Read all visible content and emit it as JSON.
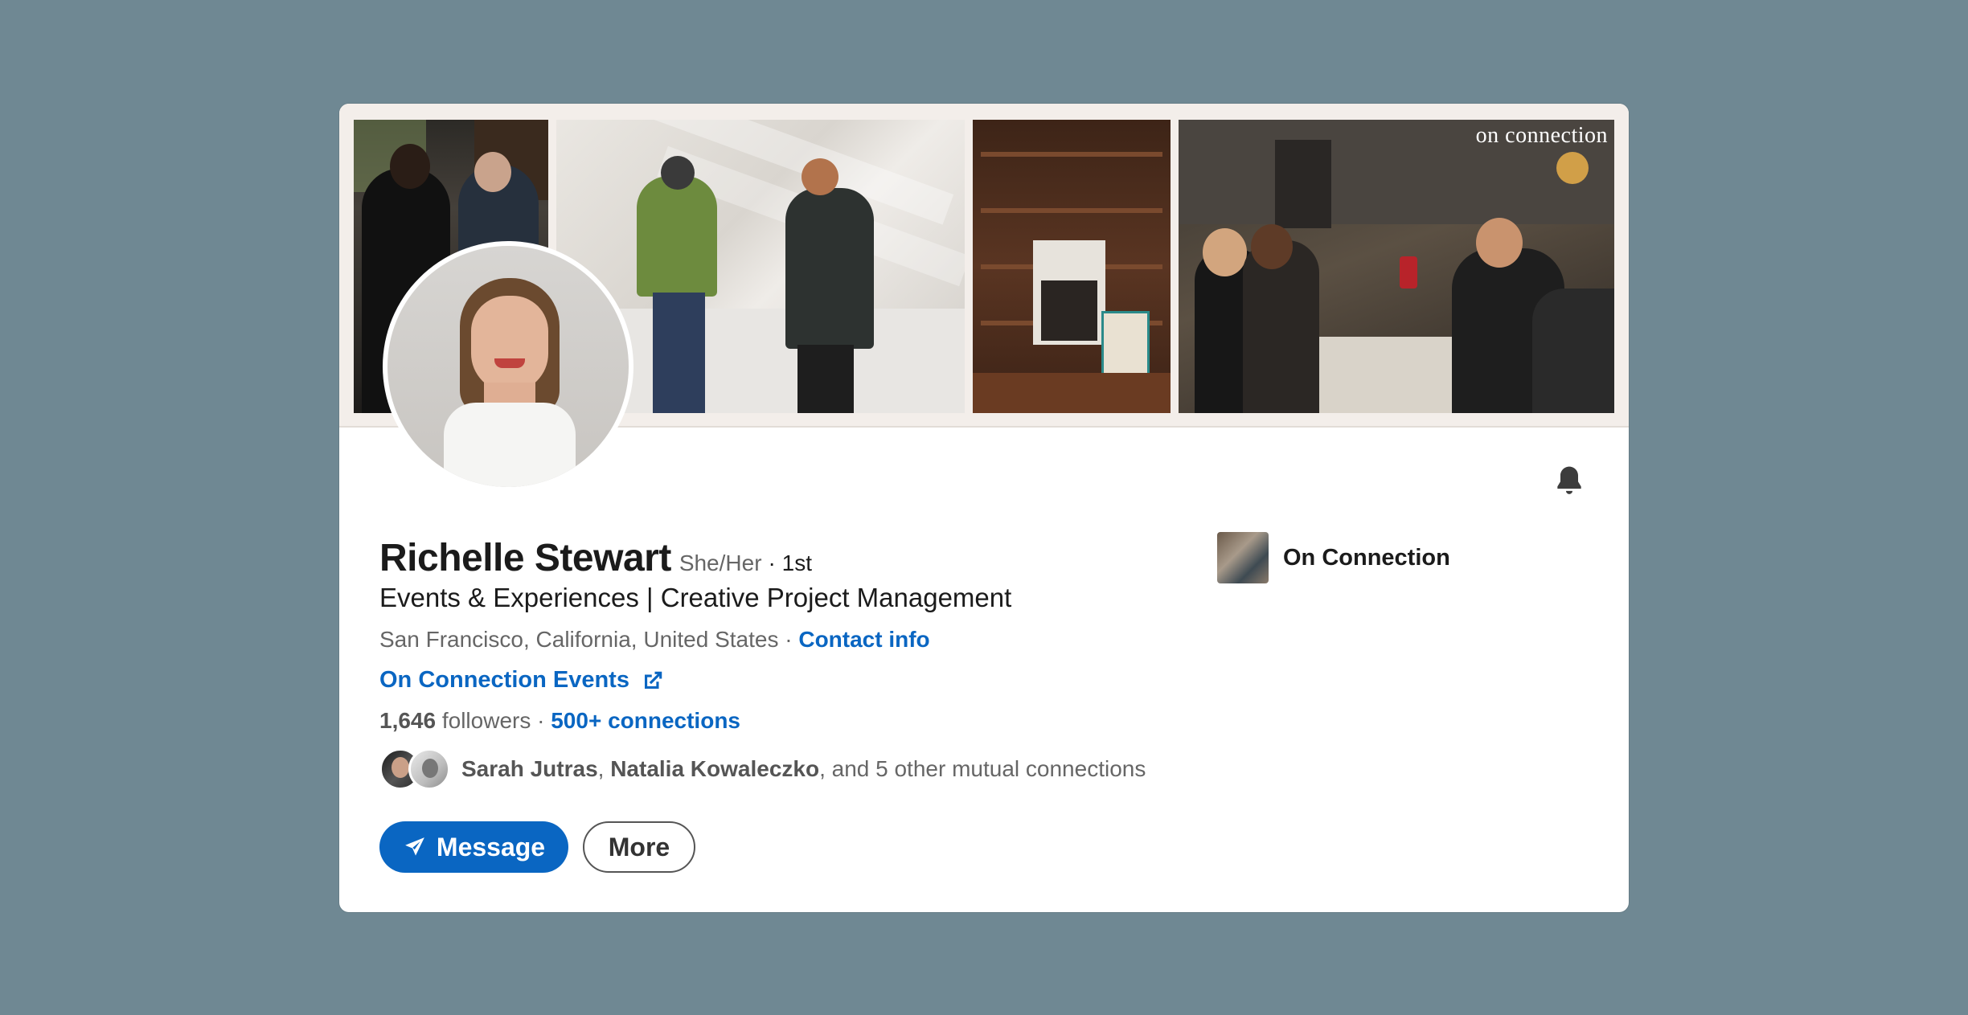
{
  "banner": {
    "watermark": "on connection"
  },
  "profile": {
    "name": "Richelle Stewart",
    "pronouns": "She/Her",
    "degree": "· 1st",
    "headline": "Events & Experiences | Creative Project Management",
    "location": "San Francisco, California, United States",
    "separator": "·",
    "contact_info": "Contact info",
    "website": "On Connection Events",
    "followers_count": "1,646",
    "followers_label": "followers",
    "connections_sep": "·",
    "connections": "500+ connections",
    "mutual": {
      "name1": "Sarah Jutras",
      "comma": ",",
      "name2": "Natalia Kowaleczko",
      "rest": ", and 5 other mutual connections"
    }
  },
  "actions": {
    "message": "Message",
    "more": "More"
  },
  "company": {
    "name": "On Connection"
  },
  "colors": {
    "background": "#6f8893",
    "accent": "#0a66c2",
    "card": "#ffffff"
  },
  "icons": [
    "bell-icon",
    "external-link-icon",
    "send-icon"
  ]
}
